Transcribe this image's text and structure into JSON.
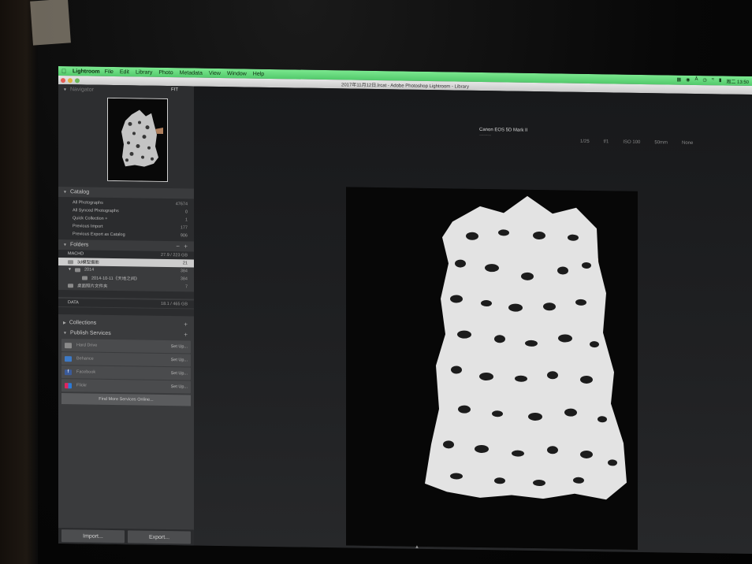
{
  "menubar": {
    "app_name": "Lightroom",
    "items": [
      "File",
      "Edit",
      "Library",
      "Photo",
      "Metadata",
      "View",
      "Window",
      "Help"
    ],
    "clock": "周二 13:50"
  },
  "window": {
    "title": "2017年11月12日.lrcat - Adobe Photoshop Lightroom - Library"
  },
  "navigator": {
    "label": "Navigator",
    "zoom": "FIT"
  },
  "catalog": {
    "label": "Catalog",
    "rows": [
      {
        "label": "All Photographs",
        "count": "47674"
      },
      {
        "label": "All Synced Photographs",
        "count": "0"
      },
      {
        "label": "Quick Collection +",
        "count": "1"
      },
      {
        "label": "Previous Import",
        "count": "177"
      },
      {
        "label": "Previous Export as Catalog",
        "count": "906"
      }
    ]
  },
  "folders": {
    "label": "Folders",
    "volume1": {
      "name": "MACHD",
      "size": "27.9 / 223 GB"
    },
    "rows": [
      {
        "label": "3d模型摄影",
        "count": "21"
      },
      {
        "label": "2014",
        "count": "384"
      },
      {
        "label": "2014-10-11《天地之间》",
        "count": "384"
      },
      {
        "label": "桌面照片文件夹",
        "count": "7"
      }
    ],
    "volume2": {
      "name": "DATA",
      "size": "18.1 / 465 GB"
    }
  },
  "collections": {
    "label": "Collections"
  },
  "publish": {
    "label": "Publish Services",
    "services": [
      {
        "name": "Hard Drive",
        "action": "Set Up..."
      },
      {
        "name": "Behance",
        "action": "Set Up..."
      },
      {
        "name": "Facebook",
        "action": "Set Up..."
      },
      {
        "name": "Flickr",
        "action": "Set Up..."
      }
    ],
    "find_more": "Find More Services Online..."
  },
  "bottom": {
    "import": "Import...",
    "export": "Export..."
  },
  "info": {
    "camera": "Canon EOS 5D Mark II",
    "exif": [
      "1/25",
      "f/1",
      "ISO 100",
      "50mm",
      "None"
    ]
  },
  "colors": {
    "menubar": "#52c96b",
    "panel": "#3a3b3d",
    "selected_row": "#cdcdcd"
  }
}
